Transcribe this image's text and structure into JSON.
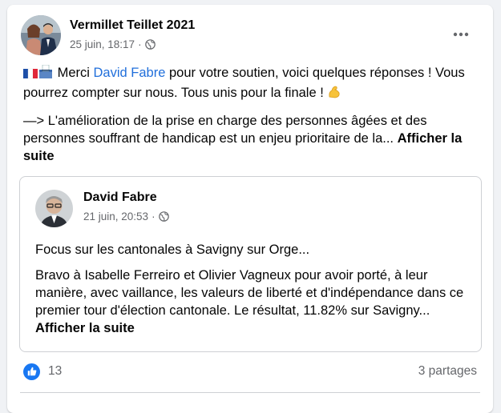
{
  "post": {
    "author": "Vermillet Teillet 2021",
    "date": "25 juin, 18:17",
    "separator": "·",
    "more_icon": "more-horizontal-icon",
    "privacy_icon": "globe-icon",
    "text_prefix": "Merci ",
    "mention": "David Fabre",
    "text_suffix": " pour votre soutien, voici quelques réponses ! Vous pourrez compter sur nous. Tous unis pour la finale ! ",
    "paragraph2": "—> L'amélioration de la prise en charge des personnes âgées et des personnes souffrant de handicap est un enjeu prioritaire de la... ",
    "see_more": "Afficher la suite"
  },
  "shared_post": {
    "author": "David Fabre",
    "date": "21 juin, 20:53",
    "separator": "·",
    "paragraph1": "Focus sur les cantonales à Savigny sur Orge...",
    "paragraph2": "Bravo à Isabelle Ferreiro et Olivier Vagneux pour avoir porté, à leur manière, avec vaillance, les valeurs de liberté et d'indépendance dans ce premier tour d'élection cantonale. Le résultat, 11.82% sur Savigny... ",
    "see_more": "Afficher la suite"
  },
  "footer": {
    "reaction_icon": "like-icon",
    "reaction_count": "13",
    "shares": "3 partages"
  },
  "colors": {
    "link": "#216fdb",
    "secondary_text": "#65676b",
    "like_blue": "#1877f2",
    "border": "#ced0d4"
  }
}
